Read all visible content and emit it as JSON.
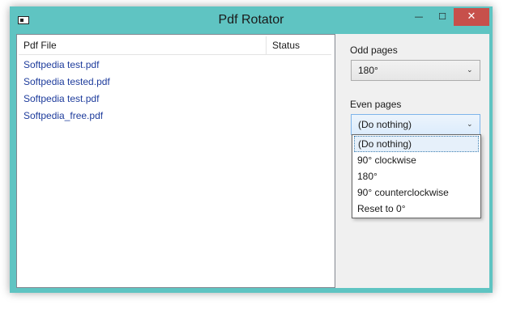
{
  "window": {
    "title": "Pdf Rotator",
    "minimize_glyph": "—",
    "maximize_glyph": "☐",
    "close_glyph": "✕"
  },
  "files": {
    "columns": [
      "Pdf File",
      "Status"
    ],
    "rows": [
      {
        "file": "Softpedia test.pdf",
        "status": ""
      },
      {
        "file": "Softpedia tested.pdf",
        "status": ""
      },
      {
        "file": "Softpedia test.pdf",
        "status": ""
      },
      {
        "file": "Softpedia_free.pdf",
        "status": ""
      }
    ]
  },
  "odd_pages": {
    "label": "Odd pages",
    "selected": "180°"
  },
  "even_pages": {
    "label": "Even pages",
    "selected": "(Do nothing)",
    "options": [
      "(Do nothing)",
      "90° clockwise",
      "180°",
      "90° counterclockwise",
      "Reset to 0°"
    ]
  },
  "colors": {
    "window_frame": "#5fc4c2",
    "close_button": "#c7504b",
    "file_link": "#1e3c9c"
  }
}
